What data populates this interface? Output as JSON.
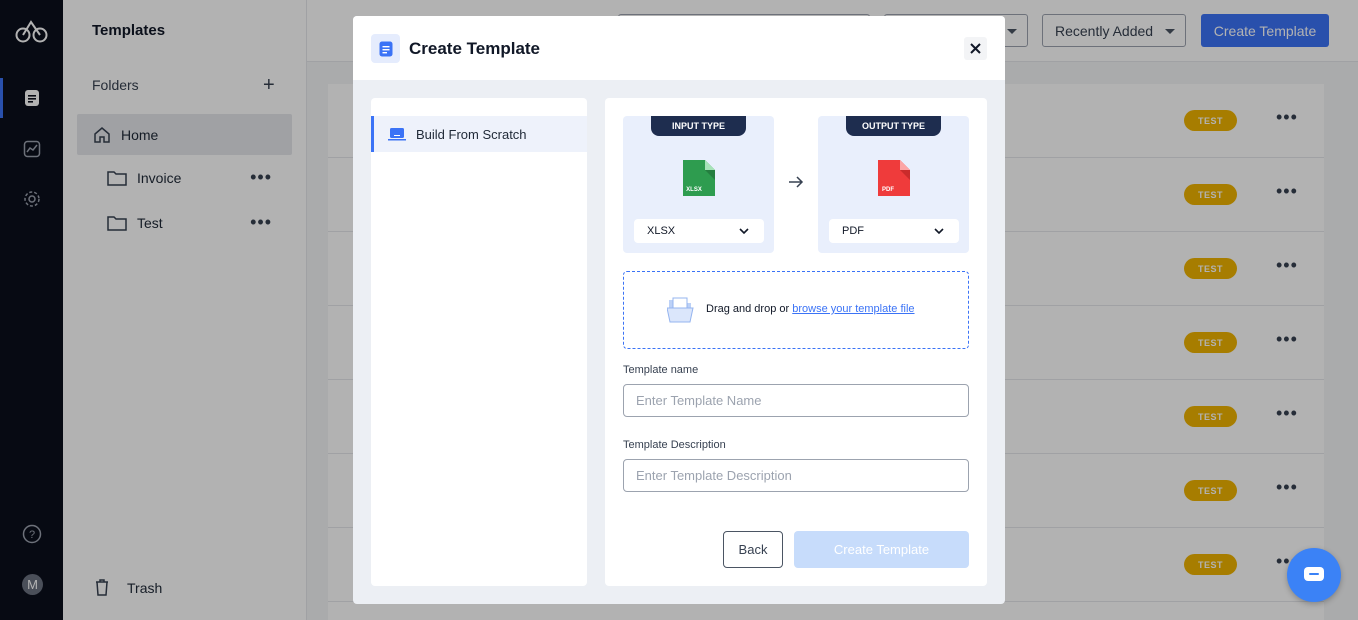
{
  "sidebar": {
    "title": "Templates",
    "folders_header": "Folders",
    "items": [
      {
        "label": "Home"
      },
      {
        "label": "Invoice"
      },
      {
        "label": "Test"
      }
    ],
    "trash_label": "Trash"
  },
  "rail": {
    "avatar_initial": "M"
  },
  "topbar": {
    "sort_value": "Recently Added",
    "create_button": "Create Template"
  },
  "list": {
    "badge_label": "TEST",
    "row_count": 7
  },
  "modal": {
    "title": "Create Template",
    "option_label": "Build From Scratch",
    "input_type_tag": "INPUT TYPE",
    "output_type_tag": "OUTPUT TYPE",
    "input_value": "XLSX",
    "output_value": "PDF",
    "input_file_label": "XLSX",
    "output_file_label": "PDF",
    "drop_text": "Drag and drop or",
    "drop_link": "browse your template file",
    "name_label": "Template name",
    "name_placeholder": "Enter Template Name",
    "desc_label": "Template Description",
    "desc_placeholder": "Enter Template Description",
    "back_button": "Back",
    "create_button": "Create Template"
  },
  "colors": {
    "accent": "#3b73f6",
    "badge": "#f0b400",
    "xlsx": "#2e9c4f",
    "pdf": "#ef3b3b",
    "dark": "#0b0f1c"
  }
}
